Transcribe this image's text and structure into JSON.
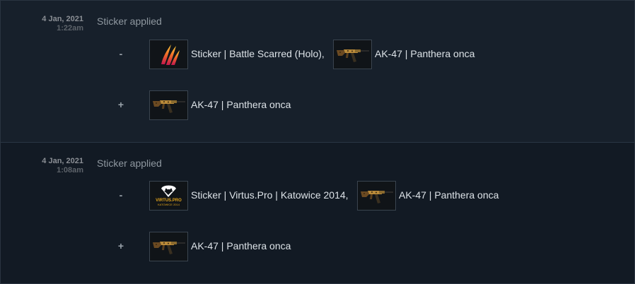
{
  "entries": [
    {
      "date": "4 Jan, 2021",
      "time": "1:22am",
      "description": "Sticker applied",
      "lost_sign": "-",
      "lost_items": [
        {
          "name": "Sticker | Battle Scarred (Holo)",
          "suffix": ",",
          "icon": "battle-scarred-sticker-icon"
        },
        {
          "name": "AK-47 | Panthera onca",
          "suffix": "",
          "icon": "ak47-icon"
        }
      ],
      "gained_sign": "+",
      "gained_items": [
        {
          "name": "AK-47 | Panthera onca",
          "icon": "ak47-icon"
        }
      ]
    },
    {
      "date": "4 Jan, 2021",
      "time": "1:08am",
      "description": "Sticker applied",
      "lost_sign": "-",
      "lost_items": [
        {
          "name": "Sticker | Virtus.Pro | Katowice 2014",
          "suffix": ",",
          "icon": "virtus-pro-sticker-icon",
          "logo_text": "VIRTUS.PRO",
          "logo_subtext": "KATOWICE 2014"
        },
        {
          "name": "AK-47 | Panthera onca",
          "suffix": "",
          "icon": "ak47-icon"
        }
      ],
      "gained_sign": "+",
      "gained_items": [
        {
          "name": "AK-47 | Panthera onca",
          "icon": "ak47-icon"
        }
      ]
    }
  ],
  "colors": {
    "background": "#0f161f",
    "entry_bg_1": "#17202b",
    "entry_bg_2": "#121a24",
    "text_light": "#dde3e8",
    "text_muted": "#8f98a0",
    "sticker_fire": "#e8692a",
    "virtus_gold": "#e0a21b"
  }
}
